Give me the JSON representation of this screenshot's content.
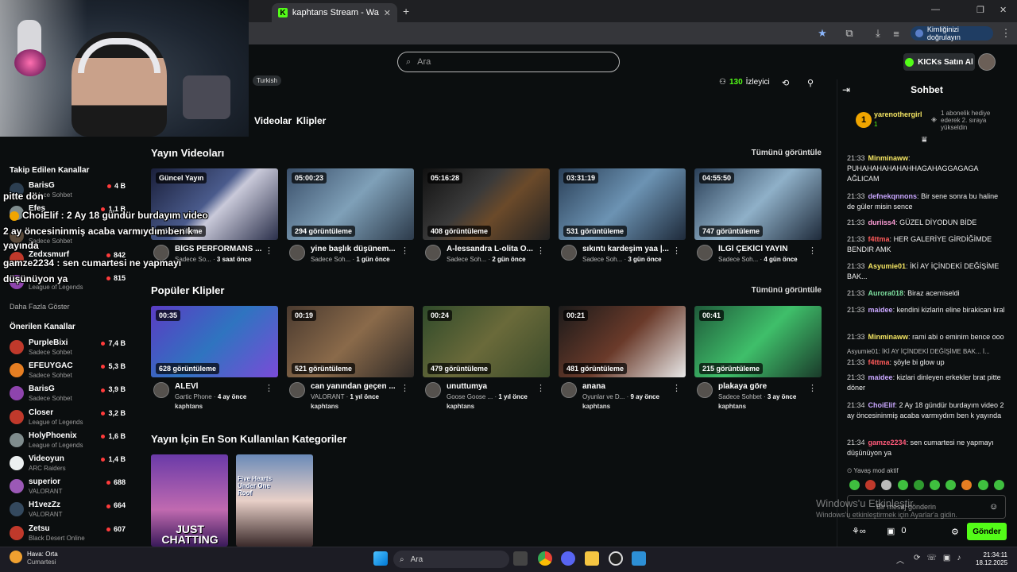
{
  "browser": {
    "tab_title": "kaphtans Stream - Watch Live o",
    "new_tab": "+",
    "verify_label": "Kimliğinizi doğrulayın"
  },
  "header": {
    "search_placeholder": "Ara",
    "buy_kicks": "KICKs Satın Al"
  },
  "channel": {
    "language": "Turkish",
    "viewers": "130",
    "viewers_label": "İzleyici",
    "tabs": [
      "Videolar",
      "Klipler"
    ]
  },
  "overlay_chat": [
    "pitte dön",
    "ChoiElif : 2 Ay 18 gündür burdayım video",
    "2 ay öncesininmiş acaba varmıydım ben k",
    "yayında",
    "gamze2234 : sen cumartesi ne yapmayı",
    "düşünüyon ya"
  ],
  "sidebar": {
    "followed_title": "Takip Edilen Kanallar",
    "followed": [
      {
        "name": "BarisG",
        "sub": "Sadece Sohbet",
        "count": "4 B"
      },
      {
        "name": "Efes",
        "sub": "",
        "count": "1,1 B"
      },
      {
        "name": "",
        "sub": "Sadece Sohbet",
        "count": ""
      },
      {
        "name": "Zedxsmurf",
        "sub": "",
        "count": "842"
      },
      {
        "name": "",
        "sub": "League of Legends",
        "count": "815"
      }
    ],
    "more": "Daha Fazla Göster",
    "recommended_title": "Önerilen Kanallar",
    "recommended": [
      {
        "name": "PurpleBixi",
        "sub": "Sadece Sohbet",
        "count": "7,4 B",
        "color": "#c0392b"
      },
      {
        "name": "EFEUYGAC",
        "sub": "Sadece Sohbet",
        "count": "5,3 B",
        "color": "#e67e22"
      },
      {
        "name": "BarisG",
        "sub": "Sadece Sohbet",
        "count": "3,9 B",
        "color": "#8e44ad"
      },
      {
        "name": "Closer",
        "sub": "League of Legends",
        "count": "3,2 B",
        "color": "#c0392b"
      },
      {
        "name": "HolyPhoenix",
        "sub": "League of Legends",
        "count": "1,6 B",
        "color": "#7f8c8d"
      },
      {
        "name": "Videoyun",
        "sub": "ARC Raiders",
        "count": "1,4 B",
        "color": "#ecf0f1"
      },
      {
        "name": "superior",
        "sub": "VALORANT",
        "count": "688",
        "color": "#9b59b6"
      },
      {
        "name": "H1vezZz",
        "sub": "VALORANT",
        "count": "664",
        "color": "#34495e"
      },
      {
        "name": "Zetsu",
        "sub": "Black Desert Online",
        "count": "607",
        "color": "#c0392b"
      }
    ]
  },
  "videos_section": {
    "title": "Yayın Videoları",
    "see_all": "Tümünü görüntüle",
    "items": [
      {
        "badge": "Güncel Yayın",
        "views": "görüntüleme",
        "title": "BİGS PERFORMANS ...",
        "sub": "Sadece So...",
        "age": "3 saat önce",
        "bg": "linear-gradient(135deg,#1a1f3a,#4a5b8c 45%,#c9c9d9 55%,#2a2f4a)"
      },
      {
        "badge": "05:00:23",
        "views": "294 görüntüleme",
        "title": "yine başlık düşünem...",
        "sub": "Sadece Soh...",
        "age": "1 gün önce",
        "bg": "linear-gradient(135deg,#3a4f6a,#7fa0b8 50%,#2c3a4a)"
      },
      {
        "badge": "05:16:28",
        "views": "408 görüntüleme",
        "title": "A-lessandra L-olita O...",
        "sub": "Sadece Soh...",
        "age": "2 gün önce",
        "bg": "linear-gradient(135deg,#111,#3a3a3a 40%,#6b4a2a 60%,#222)"
      },
      {
        "badge": "03:31:19",
        "views": "531 görüntüleme",
        "title": "sıkıntı kardeşim yaa |...",
        "sub": "Sadece Soh...",
        "age": "3 gün önce",
        "bg": "linear-gradient(135deg,#2a3f57,#6c93b3 50%,#1e2a3a)"
      },
      {
        "badge": "04:55:50",
        "views": "747 görüntüleme",
        "title": "İLGİ ÇEKİCİ YAYIN",
        "sub": "Sadece Soh...",
        "age": "4 gün önce",
        "bg": "linear-gradient(135deg,#2a3f57,#8fb0c8 50%,#1e2a3a)"
      }
    ]
  },
  "clips_section": {
    "title": "Popüler Klipler",
    "see_all": "Tümünü görüntüle",
    "items": [
      {
        "badge": "00:35",
        "views": "628 görüntüleme",
        "title": "ALEVİ",
        "game": "Gartic Phone",
        "age": "4 ay önce",
        "user": "kaphtans",
        "bg": "linear-gradient(135deg,#5b3cc4,#2f74c0 50%,#7a4bd8)"
      },
      {
        "badge": "00:19",
        "views": "521 görüntüleme",
        "title": "can yanından geçen ...",
        "game": "VALORANT",
        "age": "1 yıl önce",
        "user": "kaphtans",
        "bg": "linear-gradient(135deg,#4a3a2f,#8a6a4a 50%,#2f2a27)"
      },
      {
        "badge": "00:24",
        "views": "479 görüntüleme",
        "title": "unuttumya",
        "game": "Goose Goose ...",
        "age": "1 yıl önce",
        "user": "kaphtans",
        "bg": "linear-gradient(135deg,#2f4a2a,#6a6a3a 50%,#3a4a2a)"
      },
      {
        "badge": "00:21",
        "views": "481 görüntüleme",
        "title": "anana",
        "game": "Oyunlar ve D...",
        "age": "9 ay önce",
        "user": "kaphtans",
        "bg": "linear-gradient(135deg,#1a1a1a,#6a3a2a 50%,#e8e8e8)"
      },
      {
        "badge": "00:41",
        "views": "215 görüntüleme",
        "title": "plakaya göre",
        "game": "Sadece Sohbet",
        "age": "3 ay önce",
        "user": "kaphtans",
        "bg": "linear-gradient(135deg,#1f5a3a,#3fbf6a 50%,#1a3a2a)"
      }
    ]
  },
  "categories_section": {
    "title": "Yayın İçin En Son Kullanılan Kategoriler",
    "items": [
      {
        "label": "JUST CHATTING",
        "bg": "linear-gradient(180deg,#6a3aa8,#c06ab0 60%,#3a1a5a)"
      },
      {
        "label": "Five Hearts Under One Roof",
        "bg": "linear-gradient(180deg,#6a8ab8,#e8d0c8 50%,#3a2a2a)"
      }
    ]
  },
  "chat": {
    "title": "Sohbet",
    "pinned_user": "yarenothergirl",
    "pinned_sub": "1",
    "pinned_note": "1 abonelik hediye ederek 2. sıraya yükseldin",
    "messages": [
      {
        "time": "21:33",
        "user": "Minminaww",
        "color": "#f5e663",
        "text": "PUHAHAHAHAHAHHAGAHAGGAGAGA AĞLICAM"
      },
      {
        "time": "21:33",
        "user": "defnekqnnons",
        "color": "#c9a7ff",
        "text": "Bir sene sonra bu haline de güler misin sence"
      },
      {
        "time": "21:33",
        "user": "duriiss4",
        "color": "#ff9fd8",
        "text": "GÜZEL DİYODUN BİDE"
      },
      {
        "time": "21:33",
        "user": "f4ttma",
        "color": "#ff5a5a",
        "text": "HER GALERİYE GİRDİĞİMDE BENDIR AMK"
      },
      {
        "time": "21:33",
        "user": "Asyumie01",
        "color": "#f5e663",
        "text": "İKİ AY İÇİNDEKİ DEĞİŞİME BAK..."
      },
      {
        "time": "21:33",
        "user": "Aurora018",
        "color": "#7ee0a0",
        "text": "Biraz acemiseldi"
      },
      {
        "time": "21:33",
        "user": "maidee",
        "color": "#c9a7ff",
        "text": "kendini kizlarin eline birakican kral"
      },
      {
        "time": "21:33",
        "user": "Minminaww",
        "color": "#f5e663",
        "text": "rami abi o eminim bence ooo"
      },
      {
        "time": "",
        "user": "",
        "color": "#bbb",
        "text": "Asyumie01: İKİ AY İÇİNDEKİ DEĞİŞİME BAK... İ..."
      },
      {
        "time": "21:33",
        "user": "f4ttma",
        "color": "#ff5a5a",
        "text": "şöyle bi glow up"
      },
      {
        "time": "21:33",
        "user": "maidee",
        "color": "#c9a7ff",
        "text": "kizlari dinleyen erkekler brat pitte döner"
      },
      {
        "time": "21:34",
        "user": "ChoiElif",
        "color": "#c9a7ff",
        "text": "2 Ay 18 gündür burdayım video 2 ay öncesininmiş acaba varmıydım ben k yayında"
      },
      {
        "time": "21:34",
        "user": "gamze2234",
        "color": "#ff5a7a",
        "text": "sen cumartesi ne yapmayı düşünüyon ya"
      }
    ],
    "slow_mode": "Yavaş mod aktif",
    "input_placeholder": "Bir mesaj gönderin",
    "counter": "0",
    "send": "Gönder"
  },
  "watermark": {
    "line1": "Windows'u Etkinleştir",
    "line2": "Windows'u etkinleştirmek için Ayarlar'a gidin."
  },
  "taskbar": {
    "weather": "Hava: Orta",
    "weather_sub": "Cumartesi",
    "search": "Ara",
    "time": "21:34:11",
    "date": "18.12.2025"
  }
}
